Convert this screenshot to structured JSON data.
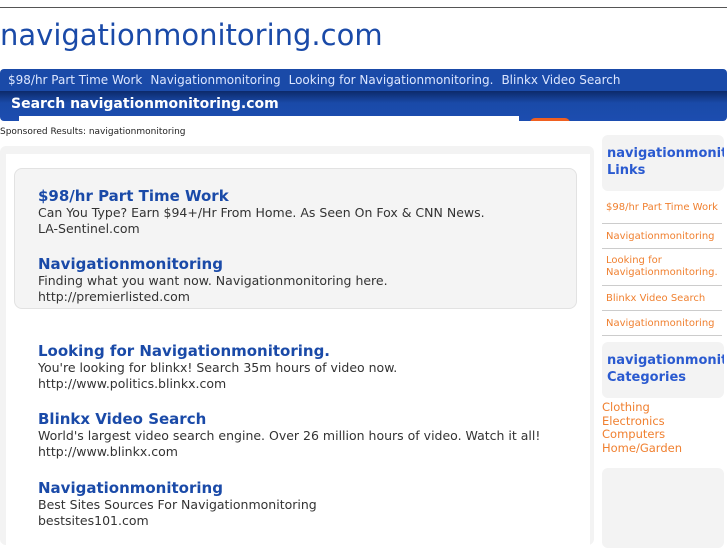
{
  "site_title": "navigationmonitoring.com",
  "nav": [
    "$98/hr Part Time Work",
    "Navigationmonitoring",
    "Looking for Navigationmonitoring.",
    "Blinkx Video Search"
  ],
  "search": {
    "title": "Search navigationmonitoring.com",
    "value": ""
  },
  "sponsored": "Sponsored Results: navigationmonitoring",
  "ads": [
    {
      "title": "$98/hr Part Time Work",
      "desc": "Can You Type? Earn $94+/Hr From Home. As Seen On Fox & CNN News.",
      "url": "LA-Sentinel.com"
    },
    {
      "title": "Navigationmonitoring",
      "desc": "Finding what you want now. Navigationmonitoring here.",
      "url": "http://premierlisted.com"
    },
    {
      "title": "Looking for Navigationmonitoring.",
      "desc": "You're looking for blinkx! Search 35m hours of video now.",
      "url": "http://www.politics.blinkx.com"
    },
    {
      "title": "Blinkx Video Search",
      "desc": "World's largest video search engine. Over 26 million hours of video. Watch it all!",
      "url": "http://www.blinkx.com"
    },
    {
      "title": "Navigationmonitoring",
      "desc": "Best Sites Sources For Navigationmonitoring",
      "url": "bestsites101.com"
    }
  ],
  "sidebar": {
    "links_heading": [
      "navigationmonitoring",
      "Links"
    ],
    "links": [
      "$98/hr Part Time Work",
      "Navigationmonitoring",
      "Looking for Navigationmonitoring.",
      "Blinkx Video Search",
      "Navigationmonitoring"
    ],
    "categories_heading": [
      "navigationmonitoring",
      "Categories"
    ],
    "categories": [
      "Clothing",
      "Electronics",
      "Computers",
      "Home/Garden"
    ]
  }
}
